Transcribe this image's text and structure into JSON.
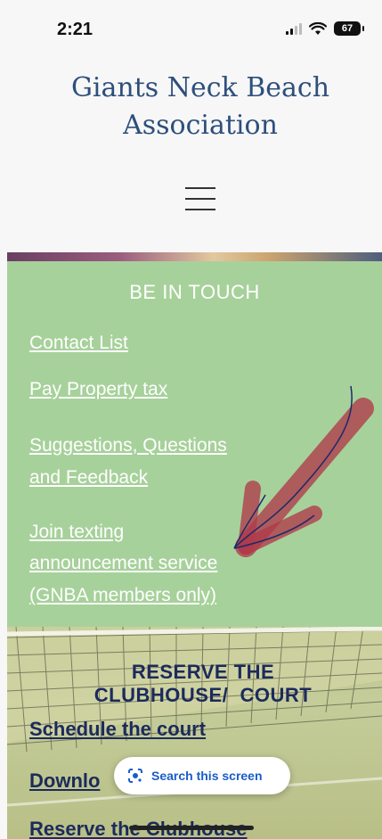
{
  "status_bar": {
    "time": "2:21",
    "battery": "67"
  },
  "header": {
    "title_line1": "Giants Neck Beach",
    "title_line2": "Association"
  },
  "touch": {
    "heading": "BE IN TOUCH",
    "links": [
      "Contact List",
      "Pay Property tax",
      "Suggestions, Questions",
      "and Feedback",
      "Join texting",
      "announcement service",
      "(GNBA members only)"
    ]
  },
  "court": {
    "heading_line1": "RESERVE THE",
    "heading_line2": "CLUBHOUSE/  COURT",
    "links": [
      "Schedule the court",
      "Downlo",
      "Reserve the Clubhouse"
    ]
  },
  "search_pill": {
    "label": "Search this screen"
  },
  "colors": {
    "green": "#a7d19b",
    "navy": "#1c2a5c",
    "title_blue": "#2e4f7c",
    "arrow_red": "#b03a4a"
  }
}
